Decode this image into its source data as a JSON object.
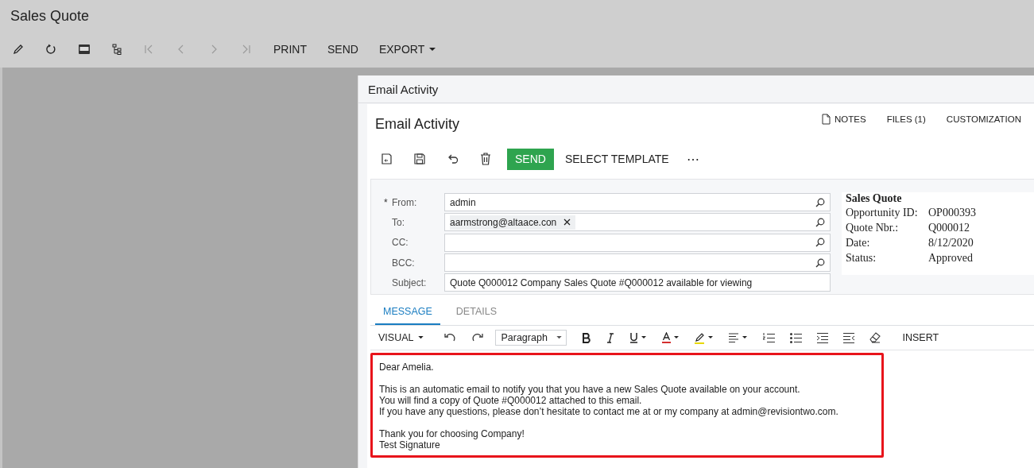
{
  "page": {
    "title": "Sales Quote"
  },
  "toolbar": {
    "navigation_disabled": true,
    "buttons": [
      {
        "label": "PRINT",
        "dropdown": false
      },
      {
        "label": "SEND",
        "dropdown": false
      },
      {
        "label": "EXPORT",
        "dropdown": true
      }
    ]
  },
  "dialog": {
    "title": "Email Activity",
    "heading": "Email Activity",
    "links": [
      {
        "label": "NOTES",
        "kind": "notes"
      },
      {
        "label": "FILES (1)",
        "kind": "plain"
      },
      {
        "label": "CUSTOMIZATION",
        "kind": "plain"
      }
    ],
    "actions": {
      "send": "SEND",
      "template": "SELECT TEMPLATE",
      "more": "⋯"
    },
    "required_mark": "*",
    "fields": [
      {
        "label": "From:",
        "required": true,
        "value": "admin",
        "lookup": true
      },
      {
        "label": "To:",
        "required": false,
        "chips": [
          "aarmstrong@altaace.con"
        ],
        "lookup": true
      },
      {
        "label": "CC:",
        "required": false,
        "lookup": true
      },
      {
        "label": "BCC:",
        "required": false,
        "lookup": true
      },
      {
        "label": "Subject:",
        "required": false,
        "value": "Quote Q000012 Company Sales Quote #Q000012 available for viewing",
        "lookup": false
      }
    ],
    "preview": {
      "title": "Sales Quote",
      "rows": [
        {
          "label": "Opportunity ID:",
          "value": "OP000393"
        },
        {
          "label": "Quote Nbr.:",
          "value": "Q000012"
        },
        {
          "label": "Date:",
          "value": "8/12/2020"
        },
        {
          "label": "Status:",
          "value": "Approved"
        }
      ]
    },
    "tabs": [
      {
        "label": "MESSAGE",
        "selected": true
      },
      {
        "label": "DETAILS",
        "selected": false
      }
    ],
    "editor": {
      "mode": "VISUAL",
      "format": "Paragraph",
      "insert": "INSERT",
      "paragraphs": [
        [
          "Dear Amelia."
        ],
        [
          "This is an automatic email to notify you that you have a new Sales Quote available on your account.",
          "You will find a copy of Quote #Q000012 attached to this email.",
          "If you have any questions, please don’t hesitate to contact me at or my company at admin@revisiontwo.com."
        ],
        [
          "Thank you for choosing Company!",
          "Test Signature"
        ]
      ],
      "highlighted": true
    }
  }
}
